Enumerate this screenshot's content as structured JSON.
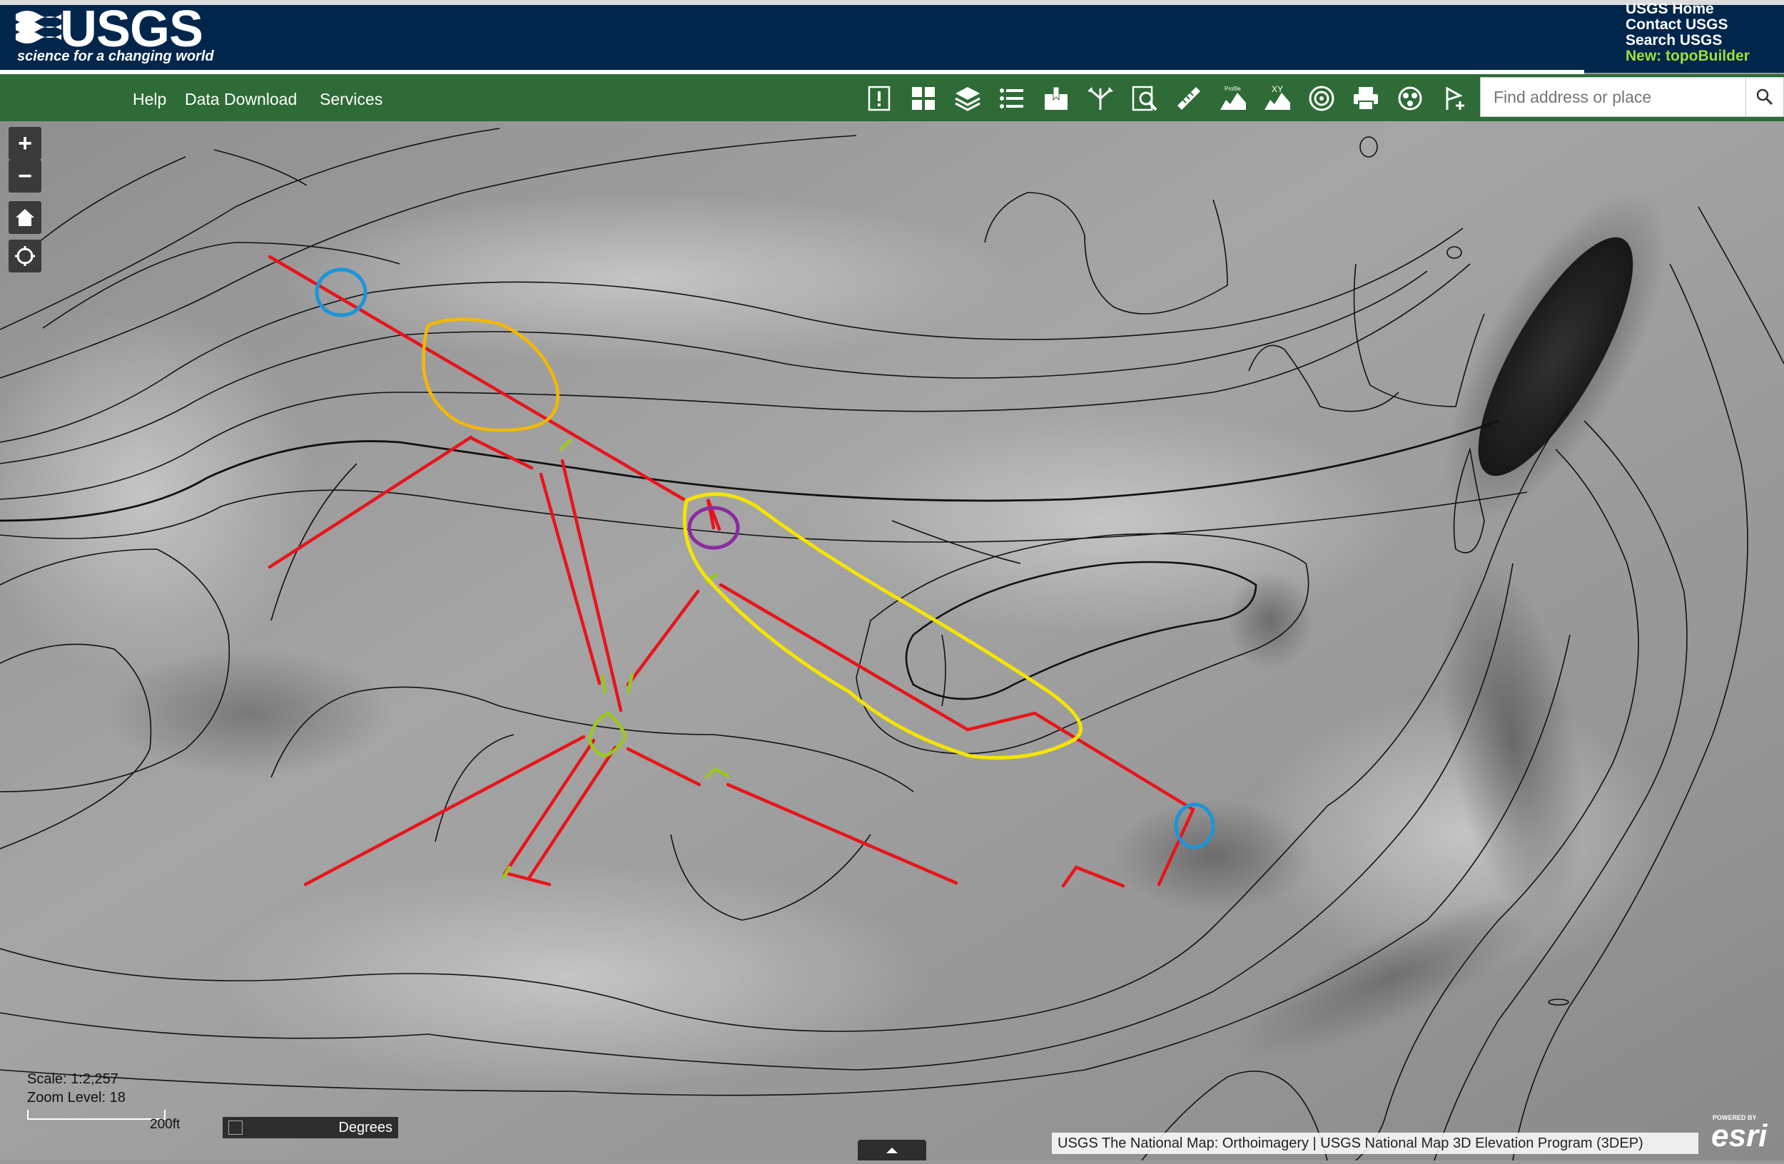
{
  "header": {
    "logo_text": "USGS",
    "tagline": "science for a changing world",
    "links": [
      "USGS Home",
      "Contact USGS",
      "Search USGS",
      "New: topoBuilder"
    ]
  },
  "nav": {
    "links": [
      "Help",
      "Data Download",
      "Services"
    ],
    "tools": [
      "alert-icon",
      "basemap-gallery-icon",
      "layers-icon",
      "legend-icon",
      "bookmark-icon",
      "navigate-icon",
      "find-icon",
      "measure-icon",
      "profile-icon",
      "xy-profile-icon",
      "spot-elevation-icon",
      "print-icon",
      "share-icon",
      "identify-icon"
    ],
    "tool_labels": {
      "profile": "Profile",
      "xy": "XY"
    }
  },
  "search": {
    "placeholder": "Find address or place"
  },
  "map_controls": {
    "zoom_in": "+",
    "zoom_out": "−"
  },
  "status": {
    "scale": "Scale: 1:2,257",
    "zoom": "Zoom Level: 18",
    "scalebar_label": "200ft",
    "coord_units": "Degrees"
  },
  "attribution": "USGS The National Map: Orthoimagery | USGS National Map 3D Elevation Program (3DEP)",
  "esri": {
    "powered": "POWERED BY",
    "name": "esri"
  },
  "colors": {
    "header_bg": "#00264c",
    "nav_bg": "#2e6b36",
    "annotation_red": "#e8141b",
    "annotation_yellow": "#f5e400",
    "annotation_orange": "#f4b800",
    "annotation_blue": "#1b95d8",
    "annotation_purple": "#8a2ca0",
    "annotation_green": "#9ac81c",
    "topbuilder_green": "#9ee03b"
  }
}
